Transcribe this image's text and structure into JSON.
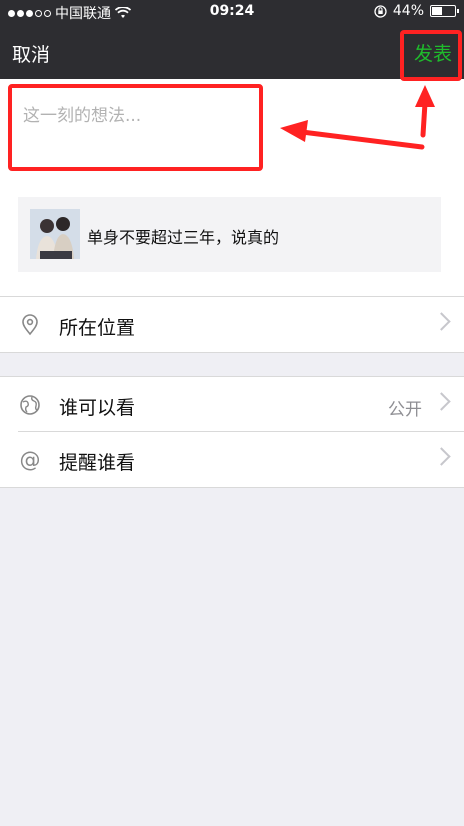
{
  "status": {
    "carrier": "中国联通",
    "time": "09:24",
    "battery": "44%",
    "battery_level": 0.44
  },
  "nav": {
    "cancel_label": "取消",
    "publish_label": "发表"
  },
  "composer": {
    "placeholder": "这一刻的想法..."
  },
  "shared_item": {
    "title": "单身不要超过三年，说真的"
  },
  "location": {
    "label": "所在位置"
  },
  "visibility": {
    "label": "谁可以看",
    "value": "公开"
  },
  "mention": {
    "label": "提醒谁看"
  },
  "colors": {
    "accent": "#1fbb2c",
    "annotation": "#ff2222"
  },
  "icons": [
    "location-pin-icon",
    "globe-icon",
    "at-icon",
    "chevron-right-icon"
  ]
}
